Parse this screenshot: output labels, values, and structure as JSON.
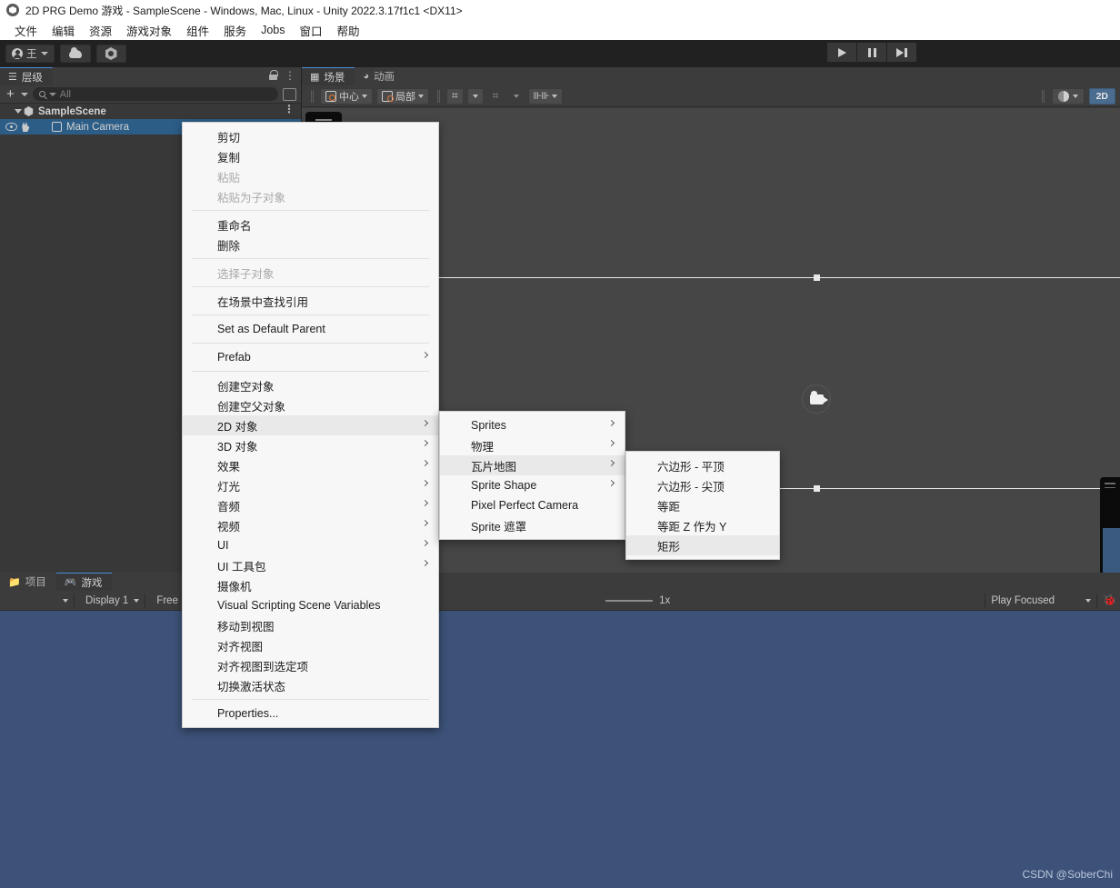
{
  "window": {
    "title": "2D PRG Demo 游戏 - SampleScene - Windows, Mac, Linux - Unity 2022.3.17f1c1 <DX11>",
    "logo_icon": "unity-logo-icon"
  },
  "menubar": {
    "items": [
      {
        "label": "文件"
      },
      {
        "label": "编辑"
      },
      {
        "label": "资源"
      },
      {
        "label": "游戏对象"
      },
      {
        "label": "组件"
      },
      {
        "label": "服务"
      },
      {
        "label": "Jobs"
      },
      {
        "label": "窗口"
      },
      {
        "label": "帮助"
      }
    ]
  },
  "toolbar": {
    "account_label": "王",
    "cloud_icon": "cloud-icon",
    "services_icon": "unity-services-icon",
    "play_icon": "play-icon",
    "pause_icon": "pause-icon",
    "step_icon": "step-icon"
  },
  "hierarchy": {
    "tab_label": "层级",
    "tab_icon": "hierarchy-icon",
    "lock_icon": "lock-icon",
    "kebab_icon": "more-options-icon",
    "add_label": "+",
    "search_placeholder": "All",
    "search_value": "",
    "search_icon": "search-icon",
    "save_search_icon": "save-search-icon",
    "rows": [
      {
        "label": "SampleScene",
        "icon": "scene-icon",
        "selected": false,
        "expanded": true
      },
      {
        "label": "Main Camera",
        "icon": "cube-icon",
        "selected": true,
        "visibility_icon": "eye-icon",
        "pickability_icon": "hand-icon"
      }
    ]
  },
  "scene_view": {
    "tabs": [
      {
        "label": "场景",
        "icon": "scene-grid-icon",
        "active": true
      },
      {
        "label": "动画",
        "icon": "animation-clock-icon",
        "active": false
      }
    ],
    "pivot_label": "中心",
    "pivot_icon": "pivot-center-icon",
    "space_label": "局部",
    "space_icon": "local-space-icon",
    "grid_snap_icon": "grid-snapping-icon",
    "grid_visibility_icon": "grid-visibility-icon",
    "ruler_icon": "ruler-icon",
    "gizmos_icon": "gizmos-icon",
    "view_mode_label": "2D",
    "overlay_handle_icon": "overlay-drag-handle-icon",
    "camera_gizmo_icon": "camera-gizmo-icon"
  },
  "bottom_panel": {
    "tabs": [
      {
        "label": "项目",
        "icon": "folder-icon",
        "active": false
      },
      {
        "label": "游戏",
        "icon": "gamepad-icon",
        "active": true
      }
    ],
    "display_label": "Display 1",
    "aspect_label": "Free",
    "scale_label": "1x",
    "play_mode_label": "Play Focused",
    "stats_icon": "bug-icon",
    "watermark": "CSDN @SoberChi"
  },
  "context_menu": {
    "items": [
      {
        "label": "剪切",
        "state": "normal"
      },
      {
        "label": "复制",
        "state": "normal"
      },
      {
        "label": "粘贴",
        "state": "disabled"
      },
      {
        "label": "粘贴为子对象",
        "state": "disabled"
      },
      {
        "type": "separator"
      },
      {
        "label": "重命名",
        "state": "normal"
      },
      {
        "label": "删除",
        "state": "normal"
      },
      {
        "type": "separator"
      },
      {
        "label": "选择子对象",
        "state": "disabled"
      },
      {
        "type": "separator"
      },
      {
        "label": "在场景中查找引用",
        "state": "normal"
      },
      {
        "type": "separator"
      },
      {
        "label": "Set as Default Parent",
        "state": "normal"
      },
      {
        "type": "separator"
      },
      {
        "label": "Prefab",
        "state": "normal",
        "submenu": true
      },
      {
        "type": "separator"
      },
      {
        "label": "创建空对象",
        "state": "normal"
      },
      {
        "label": "创建空父对象",
        "state": "normal"
      },
      {
        "label": "2D 对象",
        "state": "highlighted",
        "submenu": true
      },
      {
        "label": "3D 对象",
        "state": "normal",
        "submenu": true
      },
      {
        "label": "效果",
        "state": "normal",
        "submenu": true
      },
      {
        "label": "灯光",
        "state": "normal",
        "submenu": true
      },
      {
        "label": "音频",
        "state": "normal",
        "submenu": true
      },
      {
        "label": "视频",
        "state": "normal",
        "submenu": true
      },
      {
        "label": "UI",
        "state": "normal",
        "submenu": true
      },
      {
        "label": "UI 工具包",
        "state": "normal",
        "submenu": true
      },
      {
        "label": "摄像机",
        "state": "normal"
      },
      {
        "label": "Visual Scripting Scene Variables",
        "state": "normal"
      },
      {
        "label": "移动到视图",
        "state": "normal"
      },
      {
        "label": "对齐视图",
        "state": "normal"
      },
      {
        "label": "对齐视图到选定项",
        "state": "normal"
      },
      {
        "label": "切换激活状态",
        "state": "normal"
      },
      {
        "type": "separator"
      },
      {
        "label": "Properties...",
        "state": "normal"
      }
    ]
  },
  "submenu_2d": {
    "items": [
      {
        "label": "Sprites",
        "state": "normal",
        "submenu": true
      },
      {
        "label": "物理",
        "state": "normal",
        "submenu": true
      },
      {
        "label": "瓦片地图",
        "state": "highlighted",
        "submenu": true
      },
      {
        "label": "Sprite Shape",
        "state": "normal",
        "submenu": true
      },
      {
        "label": "Pixel Perfect Camera",
        "state": "normal"
      },
      {
        "label": "Sprite 遮罩",
        "state": "normal"
      }
    ]
  },
  "submenu_tilemap": {
    "items": [
      {
        "label": "六边形 - 平顶",
        "state": "normal"
      },
      {
        "label": "六边形 - 尖顶",
        "state": "normal"
      },
      {
        "label": "等距",
        "state": "normal"
      },
      {
        "label": "等距 Z 作为 Y",
        "state": "normal"
      },
      {
        "label": "矩形",
        "state": "highlighted"
      }
    ]
  },
  "colors": {
    "accent_blue": "#2c5d87",
    "menu_bg": "#f7f7f7",
    "panel_bg": "#383838",
    "scene_bg": "#464646",
    "game_bg": "#3d5278",
    "tab_active_underline": "#4a90d9"
  }
}
